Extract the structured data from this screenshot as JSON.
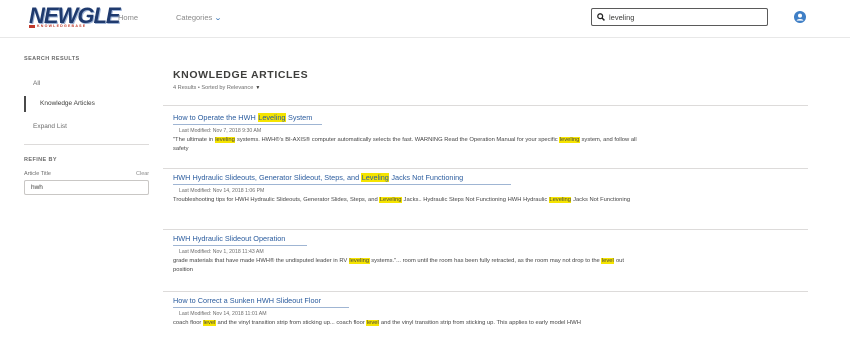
{
  "header": {
    "logo_text": "NEWGLE",
    "logo_sub": "KNOWLEDGEBASE",
    "nav": {
      "home": "Home",
      "categories": "Categories"
    },
    "search": {
      "value": "leveling",
      "icon": "search-icon"
    },
    "user_icon": "user-avatar-icon"
  },
  "sidebar": {
    "search_results_heading": "SEARCH RESULTS",
    "items": [
      {
        "label": "All"
      },
      {
        "label": "Knowledge Articles"
      },
      {
        "label": "Expand List"
      }
    ],
    "refine_heading": "REFINE BY",
    "filter_label": "Article Title",
    "clear_label": "Clear",
    "filter_value": "hwh"
  },
  "main": {
    "title": "KNOWLEDGE ARTICLES",
    "subtitle": "4 Results • Sorted by Relevance",
    "highlight_color": "#f5e400",
    "results": [
      {
        "title_parts": [
          "How to Operate the HWH ",
          "Leveling",
          " System"
        ],
        "meta": "Last Modified: Nov 7, 2018 9:30 AM",
        "snippet_parts": [
          "\"The ultimate in ",
          "leveling",
          " systems. HWH®'s BI-AXIS® computer automatically selects the fast. WARNING Read the Operation Manual for your specific ",
          "leveling",
          " system, and follow all safety"
        ]
      },
      {
        "title_parts": [
          "HWH Hydraulic Slideouts, Generator Slideout, Steps, and ",
          "Leveling",
          " Jacks Not Functioning"
        ],
        "meta": "Last Modified: Nov 14, 2018 1:06 PM",
        "snippet_parts": [
          "Troubleshooting tips for HWH Hydraulic Slideouts, Generator Slides, Steps, and ",
          "Leveling",
          " Jacks.. Hydraulic Steps Not Functioning HWH Hydraulic ",
          "Leveling",
          " Jacks Not Functioning"
        ]
      },
      {
        "title_parts": [
          "HWH Hydraulic Slideout Operation"
        ],
        "meta": "Last Modified: Nov 1, 2018 11:43 AM",
        "snippet_parts": [
          "grade materials that have made HWH® the undisputed leader in RV ",
          "leveling",
          " systems.\"... room until the room has been fully retracted, as the room may not drop to the ",
          "level",
          " out position"
        ]
      },
      {
        "title_parts": [
          "How to Correct a Sunken HWH Slideout Floor"
        ],
        "meta": "Last Modified: Nov 14, 2018 11:01 AM",
        "snippet_parts": [
          "coach floor ",
          "level",
          " and the vinyl transition strip from sticking up... coach floor ",
          "level",
          " and the vinyl transition strip from sticking up. This applies to early model HWH"
        ]
      }
    ]
  }
}
